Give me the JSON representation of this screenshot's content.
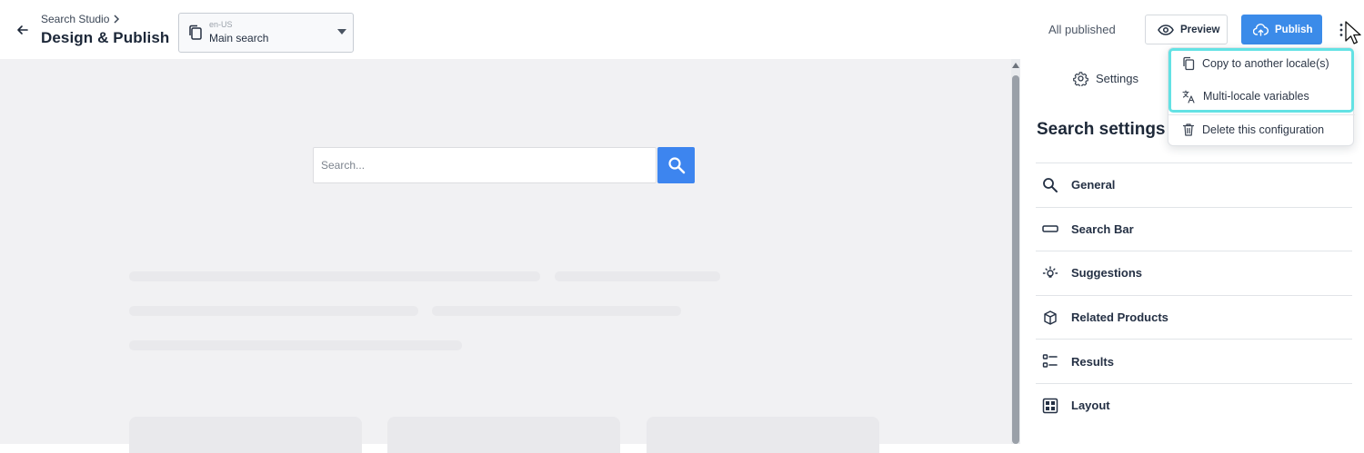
{
  "header": {
    "breadcrumb": "Search Studio",
    "title": "Design & Publish",
    "config_select": {
      "locale": "en-US",
      "value": "Main search"
    },
    "status": "All published",
    "preview_label": "Preview",
    "publish_label": "Publish"
  },
  "canvas": {
    "search_placeholder": "Search..."
  },
  "panel": {
    "tab_label": "Settings",
    "section_title": "Search settings",
    "items": [
      {
        "label": "General",
        "icon": "search-icon"
      },
      {
        "label": "Search Bar",
        "icon": "rectangle-icon"
      },
      {
        "label": "Suggestions",
        "icon": "lightbulb-icon"
      },
      {
        "label": "Related Products",
        "icon": "box-icon"
      },
      {
        "label": "Results",
        "icon": "list-icon"
      },
      {
        "label": "Layout",
        "icon": "grid-icon"
      }
    ]
  },
  "menu": {
    "items": [
      {
        "label": "Copy to another locale(s)",
        "icon": "copy-icon"
      },
      {
        "label": "Multi-locale variables",
        "icon": "translate-icon"
      },
      {
        "label": "Delete this configuration",
        "icon": "trash-icon"
      }
    ]
  },
  "colors": {
    "accent": "#3b8be9",
    "highlight": "#63e2e4",
    "canvas_bg": "#f1f1f3"
  }
}
